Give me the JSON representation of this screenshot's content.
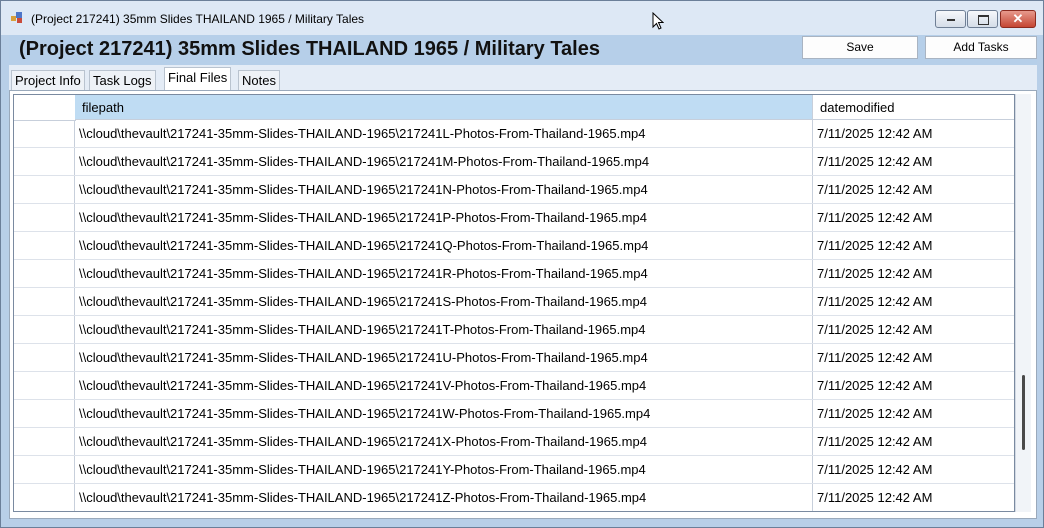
{
  "window": {
    "title": "(Project 217241) 35mm Slides THAILAND 1965 / Military Tales",
    "controls": {
      "minimize": "minimize-icon",
      "maximize": "maximize-icon",
      "close_glyph": "✕"
    }
  },
  "header": {
    "title": "(Project 217241) 35mm Slides THAILAND 1965 / Military Tales",
    "save_label": "Save",
    "add_tasks_label": "Add Tasks"
  },
  "tabs": [
    {
      "label": "Project Info"
    },
    {
      "label": "Task Logs"
    },
    {
      "label": "Final Files",
      "active": true
    },
    {
      "label": "Notes"
    }
  ],
  "table": {
    "columns": {
      "filepath": "filepath",
      "datemodified": "datemodified"
    },
    "rows": [
      {
        "filepath": "\\\\cloud\\thevault\\217241-35mm-Slides-THAILAND-1965\\217241L-Photos-From-Thailand-1965.mp4",
        "datemodified": "7/11/2025 12:42 AM"
      },
      {
        "filepath": "\\\\cloud\\thevault\\217241-35mm-Slides-THAILAND-1965\\217241M-Photos-From-Thailand-1965.mp4",
        "datemodified": "7/11/2025 12:42 AM"
      },
      {
        "filepath": "\\\\cloud\\thevault\\217241-35mm-Slides-THAILAND-1965\\217241N-Photos-From-Thailand-1965.mp4",
        "datemodified": "7/11/2025 12:42 AM"
      },
      {
        "filepath": "\\\\cloud\\thevault\\217241-35mm-Slides-THAILAND-1965\\217241P-Photos-From-Thailand-1965.mp4",
        "datemodified": "7/11/2025 12:42 AM"
      },
      {
        "filepath": "\\\\cloud\\thevault\\217241-35mm-Slides-THAILAND-1965\\217241Q-Photos-From-Thailand-1965.mp4",
        "datemodified": "7/11/2025 12:42 AM"
      },
      {
        "filepath": "\\\\cloud\\thevault\\217241-35mm-Slides-THAILAND-1965\\217241R-Photos-From-Thailand-1965.mp4",
        "datemodified": "7/11/2025 12:42 AM"
      },
      {
        "filepath": "\\\\cloud\\thevault\\217241-35mm-Slides-THAILAND-1965\\217241S-Photos-From-Thailand-1965.mp4",
        "datemodified": "7/11/2025 12:42 AM"
      },
      {
        "filepath": "\\\\cloud\\thevault\\217241-35mm-Slides-THAILAND-1965\\217241T-Photos-From-Thailand-1965.mp4",
        "datemodified": "7/11/2025 12:42 AM"
      },
      {
        "filepath": "\\\\cloud\\thevault\\217241-35mm-Slides-THAILAND-1965\\217241U-Photos-From-Thailand-1965.mp4",
        "datemodified": "7/11/2025 12:42 AM"
      },
      {
        "filepath": "\\\\cloud\\thevault\\217241-35mm-Slides-THAILAND-1965\\217241V-Photos-From-Thailand-1965.mp4",
        "datemodified": "7/11/2025 12:42 AM"
      },
      {
        "filepath": "\\\\cloud\\thevault\\217241-35mm-Slides-THAILAND-1965\\217241W-Photos-From-Thailand-1965.mp4",
        "datemodified": "7/11/2025 12:42 AM"
      },
      {
        "filepath": "\\\\cloud\\thevault\\217241-35mm-Slides-THAILAND-1965\\217241X-Photos-From-Thailand-1965.mp4",
        "datemodified": "7/11/2025 12:42 AM"
      },
      {
        "filepath": "\\\\cloud\\thevault\\217241-35mm-Slides-THAILAND-1965\\217241Y-Photos-From-Thailand-1965.mp4",
        "datemodified": "7/11/2025 12:42 AM"
      },
      {
        "filepath": "\\\\cloud\\thevault\\217241-35mm-Slides-THAILAND-1965\\217241Z-Photos-From-Thailand-1965.mp4",
        "datemodified": "7/11/2025 12:42 AM"
      }
    ]
  },
  "scrollbar": {
    "position": 0.82,
    "visible_fraction": 0.18
  },
  "colors": {
    "header_band": "#b6cfe9",
    "selected_column": "#bfdcf3",
    "close_button": "#c54633"
  }
}
